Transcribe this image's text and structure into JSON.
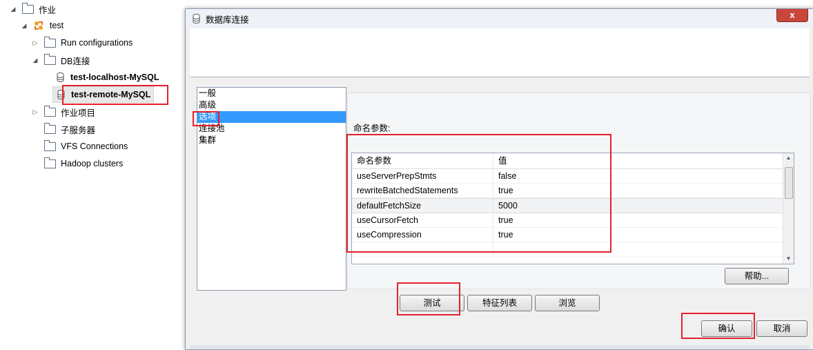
{
  "tree": {
    "root": "作业",
    "test": "test",
    "run_configurations": "Run configurations",
    "db_connections": "DB连接",
    "db_local": "test-localhost-MySQL",
    "db_remote": "test-remote-MySQL",
    "job_items": "作业项目",
    "sub_servers": "子服务器",
    "vfs": "VFS Connections",
    "hadoop": "Hadoop clusters"
  },
  "dialog": {
    "title": "数据库连接",
    "close": "x",
    "nav": [
      "一般",
      "高级",
      "选项",
      "连接池",
      "集群"
    ],
    "nav_selected": "选项",
    "params_label": "命名参数:",
    "table": {
      "headers": [
        "命名参数",
        "值"
      ],
      "rows": [
        [
          "useServerPrepStmts",
          "false"
        ],
        [
          "rewriteBatchedStatements",
          "true"
        ],
        [
          "defaultFetchSize",
          "5000"
        ],
        [
          "useCursorFetch",
          "true"
        ],
        [
          "useCompression",
          "true"
        ]
      ]
    },
    "help_button": "帮助...",
    "test_button": "测试",
    "feature_list_button": "特征列表",
    "browse_button": "浏览",
    "ok_button": "确认",
    "cancel_button": "取消"
  },
  "colors": {
    "highlight": "#3399ff",
    "annotation": "#e3202a",
    "close": "#c9463d"
  }
}
